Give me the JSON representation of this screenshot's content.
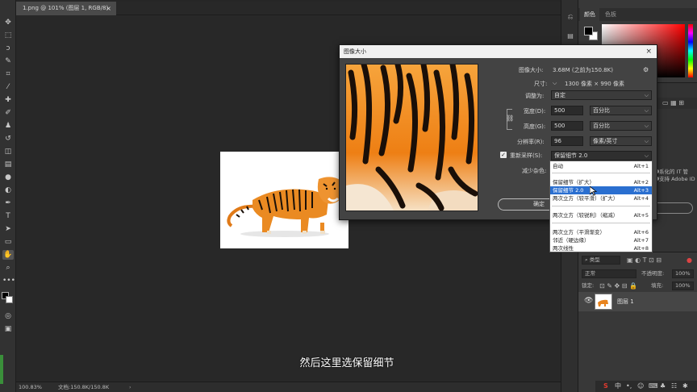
{
  "document": {
    "tab_title": "1.png @ 101% (图层 1, RGB/8)",
    "tab_close": "×"
  },
  "statusbar": {
    "zoom": "100.83%",
    "doc_info": "文档:150.8K/150.8K"
  },
  "subtitle": "然后这里选保留细节",
  "color_panel": {
    "tabs": [
      "颜色",
      "色板"
    ]
  },
  "mid_panel": {
    "adobe_note": [
      "系化的 IT 管",
      "支持 Adobe ID"
    ]
  },
  "layers_panel": {
    "filter_label": "类型",
    "blend_mode": "正常",
    "opacity_label": "不透明度:",
    "opacity_value": "100%",
    "lock_label": "锁定:",
    "fill_label": "填充:",
    "fill_value": "100%",
    "layer_name": "图层 1"
  },
  "dialog": {
    "title": "图像大小",
    "close": "×",
    "image_size_label": "图像大小:",
    "image_size_value": "3.68M (之前为150.8K)",
    "dimensions_label": "尺寸:",
    "dimensions_value": "1300 像素 × 990 像素",
    "fit_label": "调整为:",
    "fit_value": "自定",
    "width_label": "宽度(D):",
    "width_value": "500",
    "width_unit": "百分比",
    "height_label": "高度(G):",
    "height_value": "500",
    "height_unit": "百分比",
    "resolution_label": "分辨率(R):",
    "resolution_value": "96",
    "resolution_unit": "像素/英寸",
    "resample_label": "重新采样(S):",
    "resample_checked": true,
    "resample_value": "保留细节 2.0",
    "reduce_noise_label": "减少杂色:",
    "ok_label": "确定"
  },
  "resample_options": [
    {
      "label": "自动",
      "shortcut": "Alt+1"
    },
    {
      "label": "保留细节（扩大）",
      "shortcut": "Alt+2"
    },
    {
      "label": "保留细节 2.0",
      "shortcut": "Alt+3",
      "highlighted": true
    },
    {
      "label": "两次立方（较平滑）（扩大）",
      "shortcut": "Alt+4"
    },
    {
      "label": "两次立方（较锐利）（缩减）",
      "shortcut": "Alt+5"
    },
    {
      "label": "两次立方（平滑渐变）",
      "shortcut": "Alt+6"
    },
    {
      "label": "邻近（硬边缘）",
      "shortcut": "Alt+7"
    },
    {
      "label": "两次线性",
      "shortcut": "Alt+8"
    }
  ],
  "tray": [
    "S",
    "中",
    "•,",
    "☺",
    "⌨",
    "♣",
    "☷",
    "✱"
  ],
  "colors": {
    "accent": "#2a6fd0",
    "tiger_orange": "#f18a1a"
  }
}
